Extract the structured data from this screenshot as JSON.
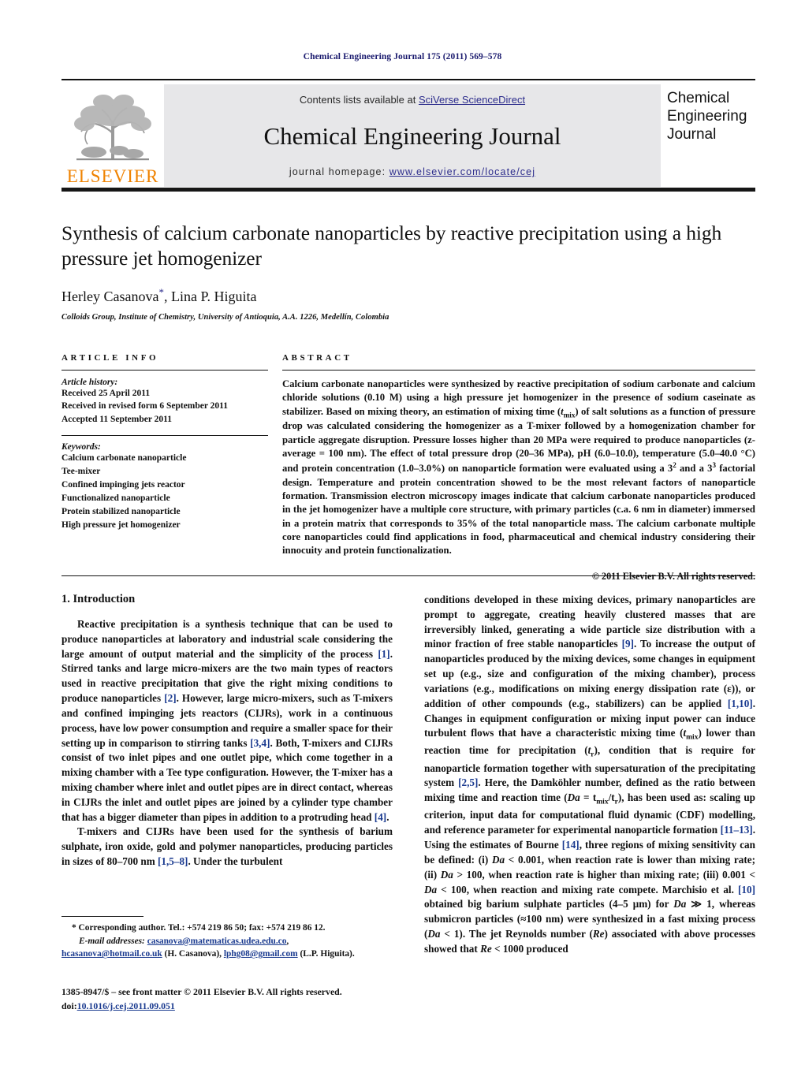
{
  "running_head": "Chemical Engineering Journal 175 (2011) 569–578",
  "masthead": {
    "logo_word": "ELSEVIER",
    "contents_prefix": "Contents lists available at ",
    "contents_link": "SciVerse ScienceDirect",
    "journal_name": "Chemical Engineering Journal",
    "homepage_prefix": "journal homepage: ",
    "homepage_url": "www.elsevier.com/locate/cej",
    "cover_line1": "Chemical",
    "cover_line2": "Engineering",
    "cover_line3": "Journal"
  },
  "title": "Synthesis of calcium carbonate nanoparticles by reactive precipitation using a high pressure jet homogenizer",
  "authors": "Herley Casanova",
  "authors_rest": ", Lina P. Higuita",
  "corresponding_marker": "*",
  "affiliation": "Colloids Group, Institute of Chemistry, University of Antioquia, A.A. 1226, Medellín, Colombia",
  "article_info": {
    "heading": "ARTICLE INFO",
    "history_label": "Article history:",
    "history": [
      "Received 25 April 2011",
      "Received in revised form 6 September 2011",
      "Accepted 11 September 2011"
    ],
    "keywords_label": "Keywords:",
    "keywords": [
      "Calcium carbonate nanoparticle",
      "Tee-mixer",
      "Confined impinging jets reactor",
      "Functionalized nanoparticle",
      "Protein stabilized nanoparticle",
      "High pressure jet homogenizer"
    ]
  },
  "abstract": {
    "heading": "ABSTRACT",
    "part1": "Calcium carbonate nanoparticles were synthesized by reactive precipitation of sodium carbonate and calcium chloride solutions (0.10 M) using a high pressure jet homogenizer in the presence of sodium caseinate as stabilizer. Based on mixing theory, an estimation of mixing time (",
    "tmix": "t",
    "tmix_sub": "mix",
    "part2": ") of salt solutions as a function of pressure drop was calculated considering the homogenizer as a T-mixer followed by a homogenization chamber for particle aggregate disruption. Pressure losses higher than 20 MPa were required to produce nanoparticles (z-average = 100 nm). The effect of total pressure drop (20–36 MPa), pH (6.0–10.0), temperature (5.0–40.0 °C) and protein concentration (1.0–3.0%) on nanoparticle formation were evaluated using a 3",
    "exp1": "2",
    "part3": " and a 3",
    "exp2": "3",
    "part4": " factorial design. Temperature and protein concentration showed to be the most relevant factors of nanoparticle formation. Transmission electron microscopy images indicate that calcium carbonate nanoparticles produced in the jet homogenizer have a multiple core structure, with primary particles (c.a. 6 nm in diameter) immersed in a protein matrix that corresponds to 35% of the total nanoparticle mass. The calcium carbonate multiple core nanoparticles could find applications in food, pharmaceutical and chemical industry considering their innocuity and protein functionalization.",
    "copyright": "© 2011 Elsevier B.V. All rights reserved."
  },
  "body": {
    "section_heading": "1. Introduction",
    "left_p1_a": "Reactive precipitation is a synthesis technique that can be used to produce nanoparticles at laboratory and industrial scale considering the large amount of output material and the simplicity of the process ",
    "ref1": "[1]",
    "left_p1_b": ". Stirred tanks and large micro-mixers are the two main types of reactors used in reactive precipitation that give the right mixing conditions to produce nanoparticles ",
    "ref2": "[2]",
    "left_p1_c": ". However, large micro-mixers, such as T-mixers and confined impinging jets reactors (CIJRs), work in a continuous process, have low power consumption and require a smaller space for their setting up in comparison to stirring tanks ",
    "ref34": "[3,4]",
    "left_p1_d": ". Both, T-mixers and CIJRs consist of two inlet pipes and one outlet pipe, which come together in a mixing chamber with a Tee type configuration. However, the T-mixer has a mixing chamber where inlet and outlet pipes are in direct contact, whereas in CIJRs the inlet and outlet pipes are joined by a cylinder type chamber that has a bigger diameter than pipes in addition to a protruding head ",
    "ref4": "[4]",
    "left_p1_e": ".",
    "left_p2_a": "T-mixers and CIJRs have been used for the synthesis of barium sulphate, iron oxide, gold and polymer nanoparticles, producing particles in sizes of 80–700 nm ",
    "ref158": "[1,5–8]",
    "left_p2_b": ". Under the turbulent",
    "right_p1_a": "conditions developed in these mixing devices, primary nanoparticles are prompt to aggregate, creating heavily clustered masses that are irreversibly linked, generating a wide particle size distribution with a minor fraction of free stable nanoparticles ",
    "ref9": "[9]",
    "right_p1_b": ". To increase the output of nanoparticles produced by the mixing devices, some changes in equipment set up (e.g., size and configuration of the mixing chamber), process variations (e.g., modifications on mixing energy dissipation rate (ε)), or addition of other compounds (e.g., stabilizers) can be applied ",
    "ref110": "[1,10]",
    "right_p1_c": ". Changes in equipment configuration or mixing input power can induce turbulent flows that have a characteristic mixing time (",
    "tmix2": "t",
    "tmix2_sub": "mix",
    "right_p1_d": ") lower than reaction time for precipitation (",
    "tr": "t",
    "tr_sub": "r",
    "right_p1_e": "), condition that is require for nanoparticle formation together with supersaturation of the precipitating system ",
    "ref25": "[2,5]",
    "right_p1_f": ". Here, the Damköhler number, defined as the ratio between mixing time and reaction time (",
    "da_eq": "Da",
    "da_eq_rest": " = t",
    "da_sub1": "mix",
    "da_slash": "/t",
    "da_sub2": "r",
    "right_p1_g": "), has been used as: scaling up criterion, input data for computational fluid dynamic (CDF) modelling, and reference parameter for experimental nanoparticle formation ",
    "ref1113": "[11–13]",
    "right_p1_h": ". Using the estimates of Bourne ",
    "ref14": "[14]",
    "right_p1_i": ", three regions of mixing sensitivity can be defined: (i) ",
    "da1": "Da",
    "right_p1_j": " < 0.001, when reaction rate is lower than mixing rate; (ii) ",
    "da2": "Da",
    "right_p1_k": " > 100, when reaction rate is higher than mixing rate; (iii) 0.001 < ",
    "da3": "Da",
    "right_p1_l": " < 100, when reaction and mixing rate compete. Marchisio et al. ",
    "ref10": "[10]",
    "right_p1_m": " obtained big barium sulphate particles (4–5 μm) for ",
    "da4": "Da",
    "right_p1_n": " ≫ 1, whereas submicron particles (≈100 nm) were synthesized in a fast mixing process (",
    "da5": "Da",
    "right_p1_o": " < 1). The jet Reynolds number (",
    "re1": "Re",
    "right_p1_p": ") associated with above processes showed that ",
    "re2": "Re",
    "right_p1_q": " < 1000 produced"
  },
  "footnotes": {
    "corresponding": "* Corresponding author. Tel.: +574 219 86 50; fax: +574 219 86 12.",
    "email_label": "E-mail addresses:",
    "email1": "casanova@matematicas.udea.edu.co",
    "email1_sep": ",",
    "email2": "hcasanova@hotmail.co.uk",
    "email2_owner": " (H. Casanova), ",
    "email3": "lphg08@gmail.com",
    "email3_owner": " (L.P. Higuita)."
  },
  "imprint": {
    "line1": "1385-8947/$ – see front matter © 2011 Elsevier B.V. All rights reserved.",
    "doi_label": "doi:",
    "doi_value": "10.1016/j.cej.2011.09.051"
  },
  "colors": {
    "link": "#2c2c8c",
    "reference": "#1a3a8f",
    "elsevier_orange": "#ef8200",
    "band_grey": "#e7e7e9"
  }
}
